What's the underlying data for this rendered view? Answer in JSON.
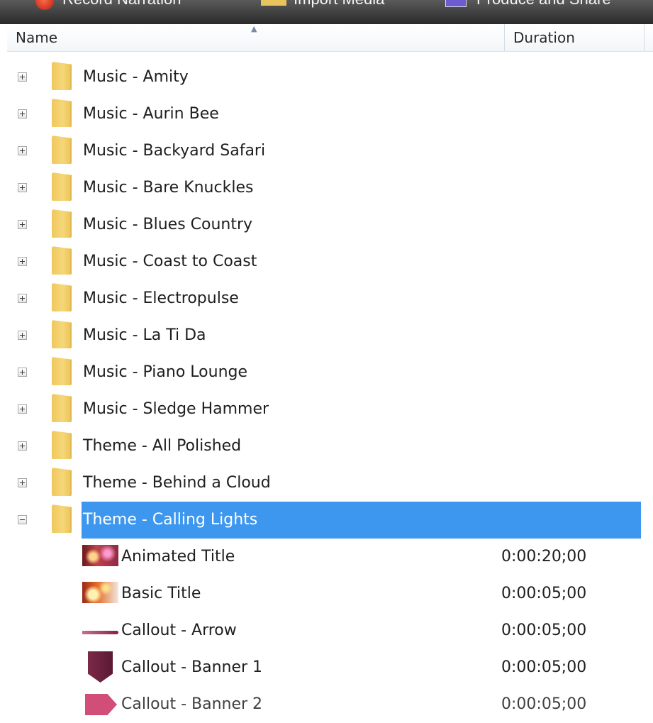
{
  "top_strip": {
    "items": [
      "Record Narration",
      "Import Media",
      "Produce and Share"
    ]
  },
  "header": {
    "name_label": "Name",
    "duration_label": "Duration",
    "sort_icon": "sort-ascending-icon"
  },
  "folders": [
    {
      "label": "Music - Amity",
      "expanded": false
    },
    {
      "label": "Music - Aurin Bee",
      "expanded": false
    },
    {
      "label": "Music - Backyard Safari",
      "expanded": false
    },
    {
      "label": "Music - Bare Knuckles",
      "expanded": false
    },
    {
      "label": "Music - Blues Country",
      "expanded": false
    },
    {
      "label": "Music - Coast to Coast",
      "expanded": false
    },
    {
      "label": "Music - Electropulse",
      "expanded": false
    },
    {
      "label": "Music - La Ti Da",
      "expanded": false
    },
    {
      "label": "Music - Piano Lounge",
      "expanded": false
    },
    {
      "label": "Music - Sledge Hammer",
      "expanded": false
    },
    {
      "label": "Theme - All Polished",
      "expanded": false
    },
    {
      "label": "Theme - Behind a Cloud",
      "expanded": false
    },
    {
      "label": "Theme - Calling Lights",
      "expanded": true,
      "selected": true
    }
  ],
  "children": [
    {
      "label": "Animated Title",
      "duration": "0:00:20;00",
      "thumb": "animated-title-thumbnail"
    },
    {
      "label": "Basic Title",
      "duration": "0:00:05;00",
      "thumb": "basic-title-thumbnail"
    },
    {
      "label": "Callout - Arrow",
      "duration": "0:00:05;00",
      "thumb": "callout-arrow-thumbnail"
    },
    {
      "label": "Callout - Banner 1",
      "duration": "0:00:05;00",
      "thumb": "callout-banner-thumbnail"
    },
    {
      "label": "Callout - Banner 2",
      "duration": "0:00:05;00",
      "thumb": "callout-banner-thumbnail"
    }
  ],
  "colors": {
    "selection": "#3e97ef",
    "folder": "#f0c75c"
  }
}
